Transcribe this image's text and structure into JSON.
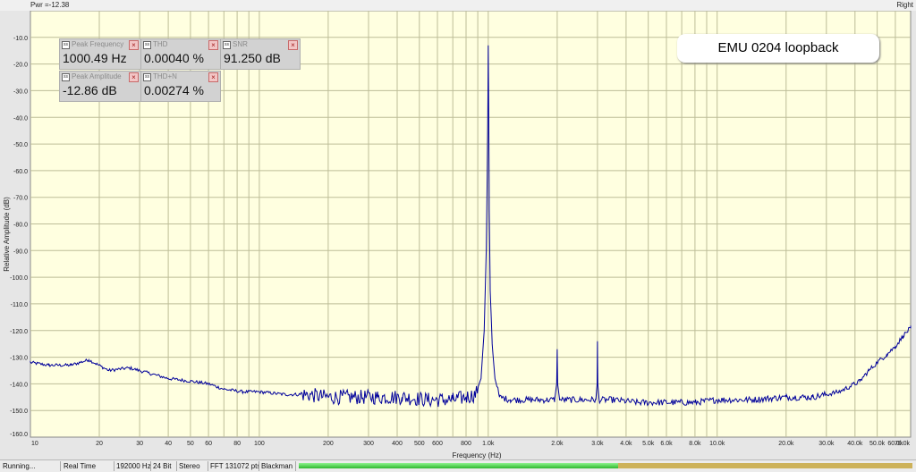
{
  "window": {
    "top_left_label": "Pwr =-12.38",
    "channel_label": "Right"
  },
  "title_box": "EMU 0204 loopback",
  "meters": [
    {
      "title": "Peak Frequency",
      "value": "1000.49 Hz"
    },
    {
      "title": "THD",
      "value": "0.00040 %"
    },
    {
      "title": "SNR",
      "value": "91.250 dB"
    },
    {
      "title": "Peak Amplitude",
      "value": "-12.86 dB"
    },
    {
      "title": "THD+N",
      "value": "0.00274 %"
    }
  ],
  "status_bar": {
    "state": "Running...",
    "mode": "Real Time",
    "sample_rate": "192000 Hz",
    "bit_depth": "24 Bit",
    "channels": "Stereo",
    "fft_size": "FFT 131072 pts",
    "window_function": "Blackman",
    "level_fraction": 0.52
  },
  "colors": {
    "plot_background": "#ffffe0",
    "grid_line": "#bdbd98",
    "trace": "#00009a"
  },
  "chart_data": {
    "type": "line",
    "title": "",
    "xlabel": "Frequency (Hz)",
    "ylabel": "Relative Amplitude (dB)",
    "x_scale": "log",
    "xlim": [
      10,
      70000
    ],
    "ylim": [
      -160,
      0
    ],
    "grid": true,
    "x_tick_labels": [
      {
        "v": 10,
        "t": "10"
      },
      {
        "v": 20,
        "t": "20"
      },
      {
        "v": 30,
        "t": "30"
      },
      {
        "v": 40,
        "t": "40"
      },
      {
        "v": 50,
        "t": "50"
      },
      {
        "v": 60,
        "t": "60"
      },
      {
        "v": 80,
        "t": "80"
      },
      {
        "v": 100,
        "t": "100"
      },
      {
        "v": 200,
        "t": "200"
      },
      {
        "v": 300,
        "t": "300"
      },
      {
        "v": 400,
        "t": "400"
      },
      {
        "v": 500,
        "t": "500"
      },
      {
        "v": 600,
        "t": "600"
      },
      {
        "v": 800,
        "t": "800"
      },
      {
        "v": 1000,
        "t": "1.0k"
      },
      {
        "v": 2000,
        "t": "2.0k"
      },
      {
        "v": 3000,
        "t": "3.0k"
      },
      {
        "v": 4000,
        "t": "4.0k"
      },
      {
        "v": 5000,
        "t": "5.0k"
      },
      {
        "v": 6000,
        "t": "6.0k"
      },
      {
        "v": 8000,
        "t": "8.0k"
      },
      {
        "v": 10000,
        "t": "10.0k"
      },
      {
        "v": 20000,
        "t": "20.0k"
      },
      {
        "v": 30000,
        "t": "30.0k"
      },
      {
        "v": 40000,
        "t": "40.0k"
      },
      {
        "v": 50000,
        "t": "50.0k"
      },
      {
        "v": 60000,
        "t": "60.0k"
      },
      {
        "v": 70000,
        "t": "70.0k"
      }
    ],
    "y_tick_labels": [
      "-10.0",
      "-20.0",
      "-30.0",
      "-40.0",
      "-50.0",
      "-60.0",
      "-70.0",
      "-80.0",
      "-90.0",
      "-100.0",
      "-110.0",
      "-120.0",
      "-130.0",
      "-140.0",
      "-150.0",
      "-160.0"
    ],
    "series": [
      {
        "color": "#00009a",
        "x": [
          10,
          12,
          15,
          18,
          22,
          27,
          33,
          40,
          50,
          60,
          70,
          85,
          100,
          130,
          160,
          200,
          260,
          330,
          420,
          550,
          700,
          800,
          880,
          930,
          960,
          980,
          990,
          995,
          1000,
          1005,
          1010,
          1020,
          1040,
          1070,
          1120,
          1250,
          1500,
          1800,
          1950,
          1990,
          2000,
          2010,
          2050,
          2500,
          2950,
          2990,
          3000,
          3010,
          3050,
          3500,
          4500,
          6000,
          8000,
          10000,
          14000,
          20000,
          26000,
          30000,
          34000,
          38000,
          42000,
          46000,
          50000,
          55000,
          60000,
          65000,
          70000
        ],
        "y": [
          -132,
          -133,
          -133,
          -131,
          -135,
          -134,
          -136,
          -138,
          -139,
          -140,
          -142,
          -143,
          -143,
          -144,
          -144,
          -145,
          -145,
          -145,
          -145,
          -146,
          -146,
          -145,
          -144,
          -138,
          -120,
          -90,
          -60,
          -40,
          -13,
          -40,
          -75,
          -105,
          -125,
          -138,
          -145,
          -146,
          -146,
          -146,
          -146,
          -140,
          -127,
          -140,
          -146,
          -146,
          -146,
          -140,
          -124,
          -140,
          -146,
          -146,
          -147,
          -147,
          -147,
          -146,
          -146,
          -145,
          -145,
          -144,
          -143,
          -141,
          -139,
          -135,
          -132,
          -129,
          -126,
          -122,
          -119
        ]
      }
    ]
  }
}
